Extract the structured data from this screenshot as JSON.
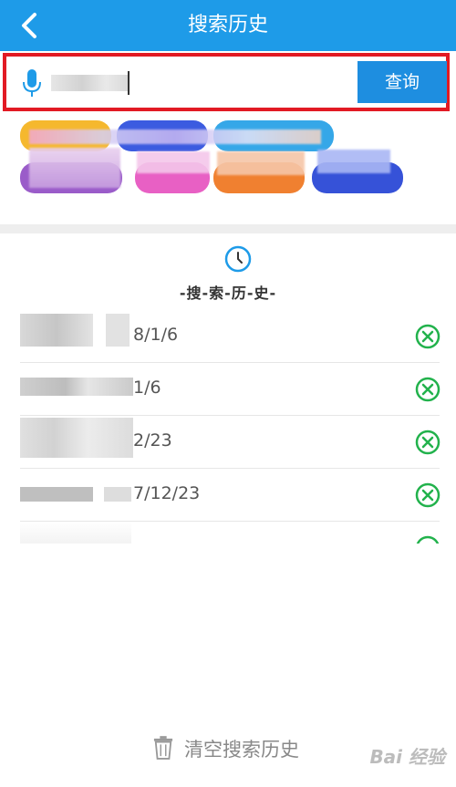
{
  "header": {
    "title": "搜索历史"
  },
  "search": {
    "value": "",
    "button_label": "查询"
  },
  "history": {
    "title": "-搜-索-历-史-",
    "items": [
      {
        "date": "8/1/6"
      },
      {
        "date": "1/6"
      },
      {
        "date": "2/23"
      },
      {
        "date": "7/12/23"
      }
    ],
    "clear_label": "清空搜索历史"
  },
  "watermark": "Bai 经验",
  "colors": {
    "accent": "#1e9be8",
    "query_button": "#1e8ee0",
    "highlight_frame": "#e21a24",
    "delete_icon": "#22b24c"
  }
}
